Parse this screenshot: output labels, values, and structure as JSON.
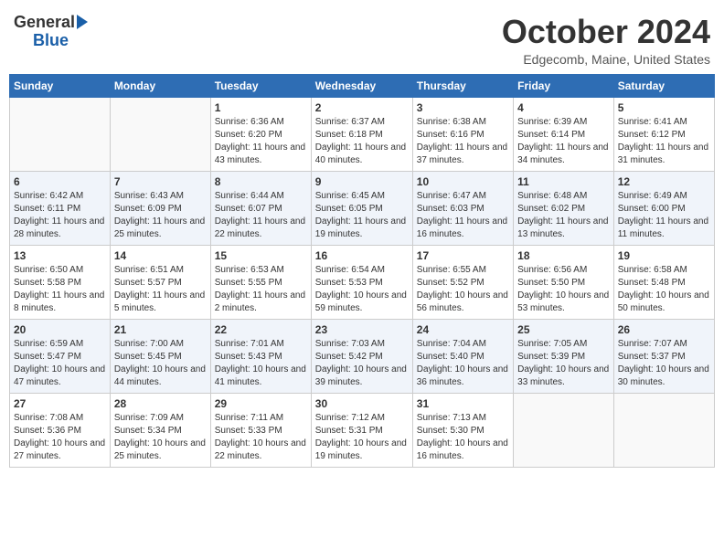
{
  "header": {
    "logo_line1": "General",
    "logo_line2": "Blue",
    "month": "October 2024",
    "location": "Edgecomb, Maine, United States"
  },
  "weekdays": [
    "Sunday",
    "Monday",
    "Tuesday",
    "Wednesday",
    "Thursday",
    "Friday",
    "Saturday"
  ],
  "weeks": [
    [
      {
        "day": "",
        "info": ""
      },
      {
        "day": "",
        "info": ""
      },
      {
        "day": "1",
        "info": "Sunrise: 6:36 AM\nSunset: 6:20 PM\nDaylight: 11 hours and 43 minutes."
      },
      {
        "day": "2",
        "info": "Sunrise: 6:37 AM\nSunset: 6:18 PM\nDaylight: 11 hours and 40 minutes."
      },
      {
        "day": "3",
        "info": "Sunrise: 6:38 AM\nSunset: 6:16 PM\nDaylight: 11 hours and 37 minutes."
      },
      {
        "day": "4",
        "info": "Sunrise: 6:39 AM\nSunset: 6:14 PM\nDaylight: 11 hours and 34 minutes."
      },
      {
        "day": "5",
        "info": "Sunrise: 6:41 AM\nSunset: 6:12 PM\nDaylight: 11 hours and 31 minutes."
      }
    ],
    [
      {
        "day": "6",
        "info": "Sunrise: 6:42 AM\nSunset: 6:11 PM\nDaylight: 11 hours and 28 minutes."
      },
      {
        "day": "7",
        "info": "Sunrise: 6:43 AM\nSunset: 6:09 PM\nDaylight: 11 hours and 25 minutes."
      },
      {
        "day": "8",
        "info": "Sunrise: 6:44 AM\nSunset: 6:07 PM\nDaylight: 11 hours and 22 minutes."
      },
      {
        "day": "9",
        "info": "Sunrise: 6:45 AM\nSunset: 6:05 PM\nDaylight: 11 hours and 19 minutes."
      },
      {
        "day": "10",
        "info": "Sunrise: 6:47 AM\nSunset: 6:03 PM\nDaylight: 11 hours and 16 minutes."
      },
      {
        "day": "11",
        "info": "Sunrise: 6:48 AM\nSunset: 6:02 PM\nDaylight: 11 hours and 13 minutes."
      },
      {
        "day": "12",
        "info": "Sunrise: 6:49 AM\nSunset: 6:00 PM\nDaylight: 11 hours and 11 minutes."
      }
    ],
    [
      {
        "day": "13",
        "info": "Sunrise: 6:50 AM\nSunset: 5:58 PM\nDaylight: 11 hours and 8 minutes."
      },
      {
        "day": "14",
        "info": "Sunrise: 6:51 AM\nSunset: 5:57 PM\nDaylight: 11 hours and 5 minutes."
      },
      {
        "day": "15",
        "info": "Sunrise: 6:53 AM\nSunset: 5:55 PM\nDaylight: 11 hours and 2 minutes."
      },
      {
        "day": "16",
        "info": "Sunrise: 6:54 AM\nSunset: 5:53 PM\nDaylight: 10 hours and 59 minutes."
      },
      {
        "day": "17",
        "info": "Sunrise: 6:55 AM\nSunset: 5:52 PM\nDaylight: 10 hours and 56 minutes."
      },
      {
        "day": "18",
        "info": "Sunrise: 6:56 AM\nSunset: 5:50 PM\nDaylight: 10 hours and 53 minutes."
      },
      {
        "day": "19",
        "info": "Sunrise: 6:58 AM\nSunset: 5:48 PM\nDaylight: 10 hours and 50 minutes."
      }
    ],
    [
      {
        "day": "20",
        "info": "Sunrise: 6:59 AM\nSunset: 5:47 PM\nDaylight: 10 hours and 47 minutes."
      },
      {
        "day": "21",
        "info": "Sunrise: 7:00 AM\nSunset: 5:45 PM\nDaylight: 10 hours and 44 minutes."
      },
      {
        "day": "22",
        "info": "Sunrise: 7:01 AM\nSunset: 5:43 PM\nDaylight: 10 hours and 41 minutes."
      },
      {
        "day": "23",
        "info": "Sunrise: 7:03 AM\nSunset: 5:42 PM\nDaylight: 10 hours and 39 minutes."
      },
      {
        "day": "24",
        "info": "Sunrise: 7:04 AM\nSunset: 5:40 PM\nDaylight: 10 hours and 36 minutes."
      },
      {
        "day": "25",
        "info": "Sunrise: 7:05 AM\nSunset: 5:39 PM\nDaylight: 10 hours and 33 minutes."
      },
      {
        "day": "26",
        "info": "Sunrise: 7:07 AM\nSunset: 5:37 PM\nDaylight: 10 hours and 30 minutes."
      }
    ],
    [
      {
        "day": "27",
        "info": "Sunrise: 7:08 AM\nSunset: 5:36 PM\nDaylight: 10 hours and 27 minutes."
      },
      {
        "day": "28",
        "info": "Sunrise: 7:09 AM\nSunset: 5:34 PM\nDaylight: 10 hours and 25 minutes."
      },
      {
        "day": "29",
        "info": "Sunrise: 7:11 AM\nSunset: 5:33 PM\nDaylight: 10 hours and 22 minutes."
      },
      {
        "day": "30",
        "info": "Sunrise: 7:12 AM\nSunset: 5:31 PM\nDaylight: 10 hours and 19 minutes."
      },
      {
        "day": "31",
        "info": "Sunrise: 7:13 AM\nSunset: 5:30 PM\nDaylight: 10 hours and 16 minutes."
      },
      {
        "day": "",
        "info": ""
      },
      {
        "day": "",
        "info": ""
      }
    ]
  ]
}
